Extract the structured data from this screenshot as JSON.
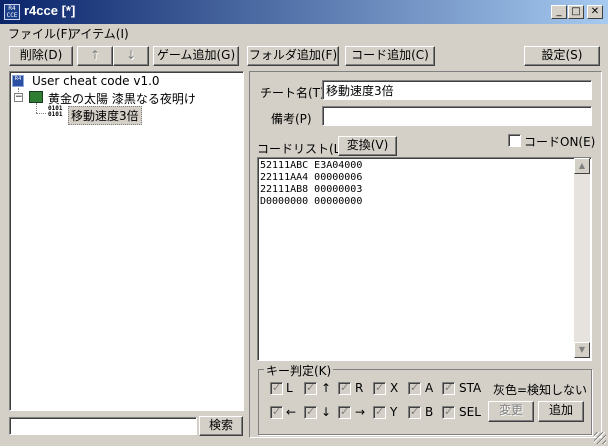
{
  "window": {
    "title": "r4cce [*]",
    "app_icon_text": "R4\nCCE",
    "minimize": "_",
    "maximize": "□",
    "close": "✕"
  },
  "menu": [
    "ファイル(F)",
    "アイテム(I)"
  ],
  "toolbar": {
    "delete": "削除(D)",
    "up": "↑",
    "down": "↓",
    "add_game": "ゲーム追加(G)",
    "add_folder": "フォルダ追加(F)",
    "add_code": "コード追加(C)",
    "settings": "設定(S)"
  },
  "tree": {
    "root": "User cheat code v1.0",
    "game": "黄金の太陽 漆黒なる夜明け",
    "code": "移動速度3倍",
    "code_icon_text": "0101\n0101"
  },
  "search": {
    "value": "",
    "button": "検索"
  },
  "form": {
    "cheat_name_label": "チート名(T)",
    "cheat_name_value": "移動速度3倍",
    "note_label": "備考(P)",
    "note_value": "",
    "code_list_label": "コードリスト(L)",
    "convert_button": "変換(V)",
    "code_on_label": "コードON(E)",
    "codes": "52111ABC E3A04000\n22111AA4 00000006\n22111AB8 00000003\nD0000000 00000000"
  },
  "key_judge": {
    "group_label": "キー判定(K)",
    "row1": [
      "L",
      "↑",
      "R",
      "X",
      "A",
      "STA"
    ],
    "row1_note": "灰色=検知しない",
    "row2": [
      "←",
      "↓",
      "→",
      "Y",
      "B",
      "SEL"
    ],
    "change_button": "変更",
    "add_button": "追加"
  }
}
